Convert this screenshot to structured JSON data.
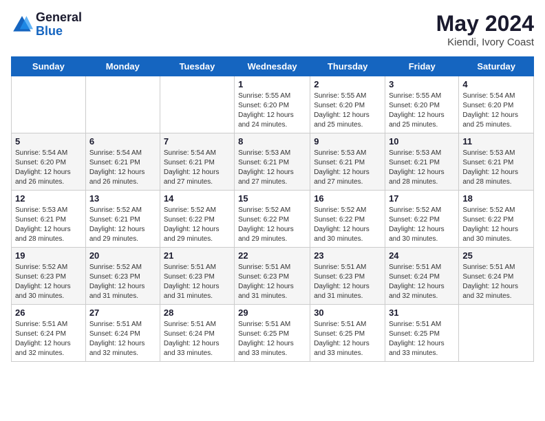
{
  "logo": {
    "general": "General",
    "blue": "Blue"
  },
  "title": {
    "month": "May 2024",
    "location": "Kiendi, Ivory Coast"
  },
  "weekdays": [
    "Sunday",
    "Monday",
    "Tuesday",
    "Wednesday",
    "Thursday",
    "Friday",
    "Saturday"
  ],
  "weeks": [
    [
      {
        "day": "",
        "info": ""
      },
      {
        "day": "",
        "info": ""
      },
      {
        "day": "",
        "info": ""
      },
      {
        "day": "1",
        "info": "Sunrise: 5:55 AM\nSunset: 6:20 PM\nDaylight: 12 hours and 24 minutes."
      },
      {
        "day": "2",
        "info": "Sunrise: 5:55 AM\nSunset: 6:20 PM\nDaylight: 12 hours and 25 minutes."
      },
      {
        "day": "3",
        "info": "Sunrise: 5:55 AM\nSunset: 6:20 PM\nDaylight: 12 hours and 25 minutes."
      },
      {
        "day": "4",
        "info": "Sunrise: 5:54 AM\nSunset: 6:20 PM\nDaylight: 12 hours and 25 minutes."
      }
    ],
    [
      {
        "day": "5",
        "info": "Sunrise: 5:54 AM\nSunset: 6:20 PM\nDaylight: 12 hours and 26 minutes."
      },
      {
        "day": "6",
        "info": "Sunrise: 5:54 AM\nSunset: 6:21 PM\nDaylight: 12 hours and 26 minutes."
      },
      {
        "day": "7",
        "info": "Sunrise: 5:54 AM\nSunset: 6:21 PM\nDaylight: 12 hours and 27 minutes."
      },
      {
        "day": "8",
        "info": "Sunrise: 5:53 AM\nSunset: 6:21 PM\nDaylight: 12 hours and 27 minutes."
      },
      {
        "day": "9",
        "info": "Sunrise: 5:53 AM\nSunset: 6:21 PM\nDaylight: 12 hours and 27 minutes."
      },
      {
        "day": "10",
        "info": "Sunrise: 5:53 AM\nSunset: 6:21 PM\nDaylight: 12 hours and 28 minutes."
      },
      {
        "day": "11",
        "info": "Sunrise: 5:53 AM\nSunset: 6:21 PM\nDaylight: 12 hours and 28 minutes."
      }
    ],
    [
      {
        "day": "12",
        "info": "Sunrise: 5:53 AM\nSunset: 6:21 PM\nDaylight: 12 hours and 28 minutes."
      },
      {
        "day": "13",
        "info": "Sunrise: 5:52 AM\nSunset: 6:21 PM\nDaylight: 12 hours and 29 minutes."
      },
      {
        "day": "14",
        "info": "Sunrise: 5:52 AM\nSunset: 6:22 PM\nDaylight: 12 hours and 29 minutes."
      },
      {
        "day": "15",
        "info": "Sunrise: 5:52 AM\nSunset: 6:22 PM\nDaylight: 12 hours and 29 minutes."
      },
      {
        "day": "16",
        "info": "Sunrise: 5:52 AM\nSunset: 6:22 PM\nDaylight: 12 hours and 30 minutes."
      },
      {
        "day": "17",
        "info": "Sunrise: 5:52 AM\nSunset: 6:22 PM\nDaylight: 12 hours and 30 minutes."
      },
      {
        "day": "18",
        "info": "Sunrise: 5:52 AM\nSunset: 6:22 PM\nDaylight: 12 hours and 30 minutes."
      }
    ],
    [
      {
        "day": "19",
        "info": "Sunrise: 5:52 AM\nSunset: 6:23 PM\nDaylight: 12 hours and 30 minutes."
      },
      {
        "day": "20",
        "info": "Sunrise: 5:52 AM\nSunset: 6:23 PM\nDaylight: 12 hours and 31 minutes."
      },
      {
        "day": "21",
        "info": "Sunrise: 5:51 AM\nSunset: 6:23 PM\nDaylight: 12 hours and 31 minutes."
      },
      {
        "day": "22",
        "info": "Sunrise: 5:51 AM\nSunset: 6:23 PM\nDaylight: 12 hours and 31 minutes."
      },
      {
        "day": "23",
        "info": "Sunrise: 5:51 AM\nSunset: 6:23 PM\nDaylight: 12 hours and 31 minutes."
      },
      {
        "day": "24",
        "info": "Sunrise: 5:51 AM\nSunset: 6:24 PM\nDaylight: 12 hours and 32 minutes."
      },
      {
        "day": "25",
        "info": "Sunrise: 5:51 AM\nSunset: 6:24 PM\nDaylight: 12 hours and 32 minutes."
      }
    ],
    [
      {
        "day": "26",
        "info": "Sunrise: 5:51 AM\nSunset: 6:24 PM\nDaylight: 12 hours and 32 minutes."
      },
      {
        "day": "27",
        "info": "Sunrise: 5:51 AM\nSunset: 6:24 PM\nDaylight: 12 hours and 32 minutes."
      },
      {
        "day": "28",
        "info": "Sunrise: 5:51 AM\nSunset: 6:24 PM\nDaylight: 12 hours and 33 minutes."
      },
      {
        "day": "29",
        "info": "Sunrise: 5:51 AM\nSunset: 6:25 PM\nDaylight: 12 hours and 33 minutes."
      },
      {
        "day": "30",
        "info": "Sunrise: 5:51 AM\nSunset: 6:25 PM\nDaylight: 12 hours and 33 minutes."
      },
      {
        "day": "31",
        "info": "Sunrise: 5:51 AM\nSunset: 6:25 PM\nDaylight: 12 hours and 33 minutes."
      },
      {
        "day": "",
        "info": ""
      }
    ]
  ]
}
